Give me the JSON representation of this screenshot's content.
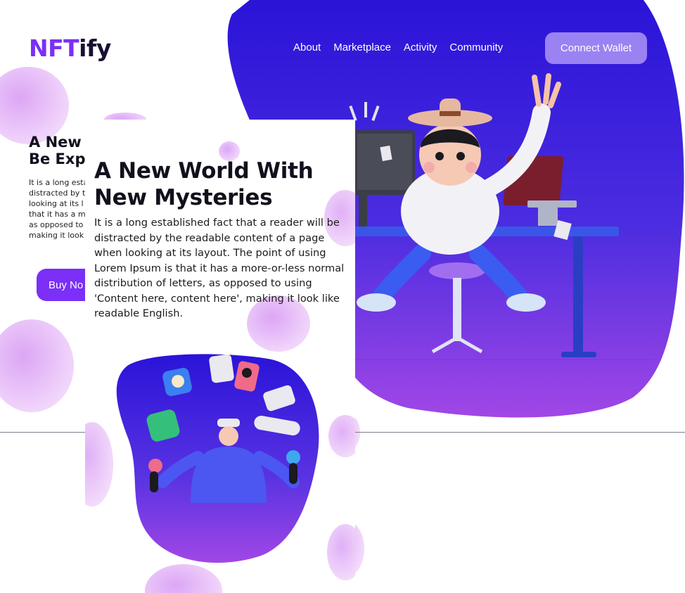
{
  "brand": {
    "name_main": "NFT",
    "name_accent": "ify",
    "accent_color": "#7b2ff7",
    "text_color": "#1a1033"
  },
  "nav": {
    "items": [
      "About",
      "Marketplace",
      "Activity",
      "Community"
    ]
  },
  "connect_button": {
    "label": "Connect Wallet",
    "color": "#9b82f3"
  },
  "desktop_hero": {
    "title_line1": "A New",
    "title_line2": "Be Exp",
    "paragraph_lines": [
      "It is a long esta",
      "distracted by t",
      "looking at its l",
      "that it has a m",
      "as opposed to",
      "making it look"
    ],
    "buy_label": "Buy No",
    "buy_color": "#7b2ff7"
  },
  "mobile_hero": {
    "title": "A New World With New Mysteries",
    "paragraph": "It is a long established fact that a reader will be distracted by the readable content of a page when looking at its layout. The point of using Lorem Ipsum is that it has a more-or-less normal distribution of letters, as opposed to using 'Content here, content here', making it look like readable English."
  },
  "colors": {
    "blob_top": "#2a14d8",
    "blob_bottom": "#a147e6",
    "bubble": "#e4b8f7"
  }
}
